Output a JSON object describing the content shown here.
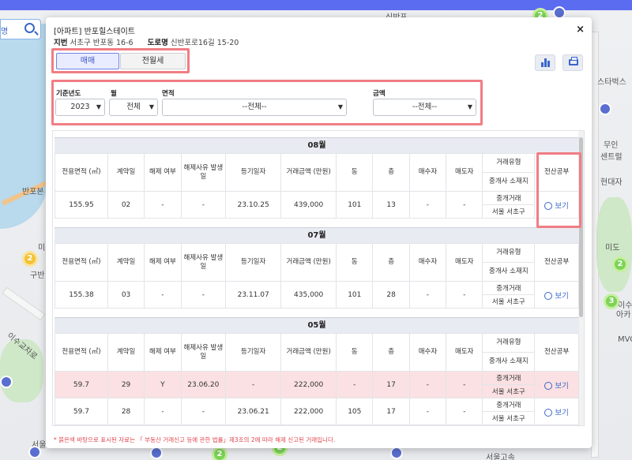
{
  "map": {
    "labels": [
      "신반포",
      "스타벅스",
      "반포본",
      "미소",
      "구반",
      "이수교차로",
      "현대자",
      "미도",
      "무인",
      "이수",
      "센트럴",
      "아카",
      "MVO",
      "서울지",
      "서울고속"
    ]
  },
  "popup": {
    "title": "[아파트] 반포힐스테이트",
    "address": {
      "jibun_label": "지번",
      "jibun_value": "서초구 반포동 16-6",
      "road_label": "도로명",
      "road_value": "신반포로16길 15-20"
    },
    "close_glyph": "×"
  },
  "tabs": [
    {
      "label": "매매",
      "active": true
    },
    {
      "label": "전월세",
      "active": false
    }
  ],
  "toolbar": {
    "chart_icon": "bar-chart-icon",
    "print_icon": "printer-icon"
  },
  "filters": {
    "year": {
      "label": "기준년도",
      "value": "2023"
    },
    "month": {
      "label": "월",
      "value": "전체"
    },
    "area": {
      "label": "면적",
      "value": "--전체--"
    },
    "amount": {
      "label": "금액",
      "value": "--전체--"
    }
  },
  "table_headers": {
    "area": "전용면적 (㎡)",
    "contract_day": "계약일",
    "cancel": "해제 여부",
    "cancel_date": "해제사유 발생일",
    "reg_date": "등기일자",
    "price": "거래금액 (만원)",
    "dong": "동",
    "floor": "층",
    "buyer": "매수자",
    "seller": "매도자",
    "deal_type": "거래유형",
    "agent_loc": "중개사 소재지",
    "ledger": "전산공부"
  },
  "months": [
    {
      "label": "08월",
      "rows": [
        {
          "area": "155.95",
          "day": "02",
          "cancel": "-",
          "cancel_date": "-",
          "reg": "23.10.25",
          "price": "439,000",
          "dong": "101",
          "floor": "13",
          "buyer": "-",
          "seller": "-",
          "type": "중개거래",
          "loc": "서울 서초구",
          "view": "보기",
          "cancelled": false
        }
      ]
    },
    {
      "label": "07월",
      "rows": [
        {
          "area": "155.38",
          "day": "03",
          "cancel": "-",
          "cancel_date": "-",
          "reg": "23.11.07",
          "price": "435,000",
          "dong": "101",
          "floor": "28",
          "buyer": "-",
          "seller": "-",
          "type": "중개거래",
          "loc": "서울 서초구",
          "view": "보기",
          "cancelled": false
        }
      ]
    },
    {
      "label": "05월",
      "rows": [
        {
          "area": "59.7",
          "day": "29",
          "cancel": "Y",
          "cancel_date": "23.06.20",
          "reg": "-",
          "price": "222,000",
          "dong": "-",
          "floor": "17",
          "buyer": "-",
          "seller": "-",
          "type": "중개거래",
          "loc": "서울 서초구",
          "view": "보기",
          "cancelled": true
        },
        {
          "area": "59.7",
          "day": "28",
          "cancel": "-",
          "cancel_date": "-",
          "reg": "23.06.21",
          "price": "222,000",
          "dong": "105",
          "floor": "17",
          "buyer": "-",
          "seller": "-",
          "type": "중개거래",
          "loc": "서울 서초구",
          "view": "보기",
          "cancelled": false
        }
      ]
    }
  ],
  "footnote": "* 붉은색 바탕으로 표시된 자료는 「 부동산 거래신고 등에 관한 법률」제3조의 2에 따라 해제 신고된 거래입니다.",
  "colors": {
    "highlight_border": "#f07d84",
    "accent": "#3a67c8",
    "cancelled_row": "#fbe1e3"
  }
}
